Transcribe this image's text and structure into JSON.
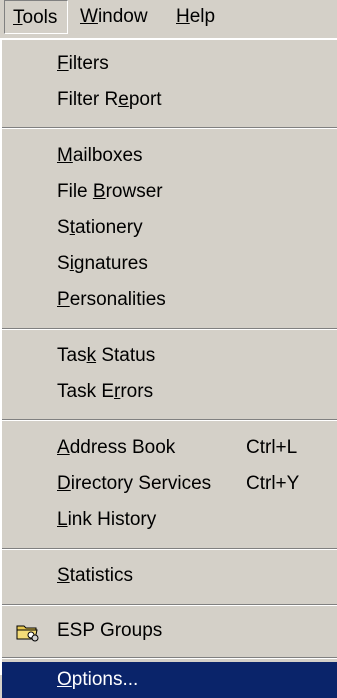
{
  "menubar": {
    "tools": {
      "accel": "T",
      "rest": "ools"
    },
    "window": {
      "accel": "W",
      "rest": "indow"
    },
    "help": {
      "accel": "H",
      "rest": "elp"
    }
  },
  "menu": {
    "filters": {
      "pre": "",
      "accel": "F",
      "post": "ilters"
    },
    "filter_report": {
      "pre": "Filter R",
      "accel": "e",
      "post": "port"
    },
    "mailboxes": {
      "pre": "",
      "accel": "M",
      "post": "ailboxes"
    },
    "file_browser": {
      "pre": "File ",
      "accel": "B",
      "post": "rowser"
    },
    "stationery": {
      "pre": "S",
      "accel": "t",
      "post": "ationery"
    },
    "signatures": {
      "pre": "S",
      "accel": "i",
      "post": "gnatures"
    },
    "personalities": {
      "pre": "",
      "accel": "P",
      "post": "ersonalities"
    },
    "task_status": {
      "pre": "Tas",
      "accel": "k",
      "post": " Status"
    },
    "task_errors": {
      "pre": "Task E",
      "accel": "r",
      "post": "rors"
    },
    "address_book": {
      "pre": "",
      "accel": "A",
      "post": "ddress Book",
      "shortcut": "Ctrl+L"
    },
    "directory_services": {
      "pre": "",
      "accel": "D",
      "post": "irectory Services",
      "shortcut": "Ctrl+Y"
    },
    "link_history": {
      "pre": "",
      "accel": "L",
      "post": "ink History"
    },
    "statistics": {
      "pre": "",
      "accel": "S",
      "post": "tatistics"
    },
    "esp_groups": {
      "pre": "ESP Groups",
      "accel": "",
      "post": "",
      "icon": "folder-group-icon"
    },
    "options": {
      "pre": "",
      "accel": "O",
      "post": "ptions..."
    }
  },
  "colors": {
    "menu_bg": "#d4d0c8",
    "highlight": "#0a246a",
    "highlight_text": "#ffffff"
  }
}
